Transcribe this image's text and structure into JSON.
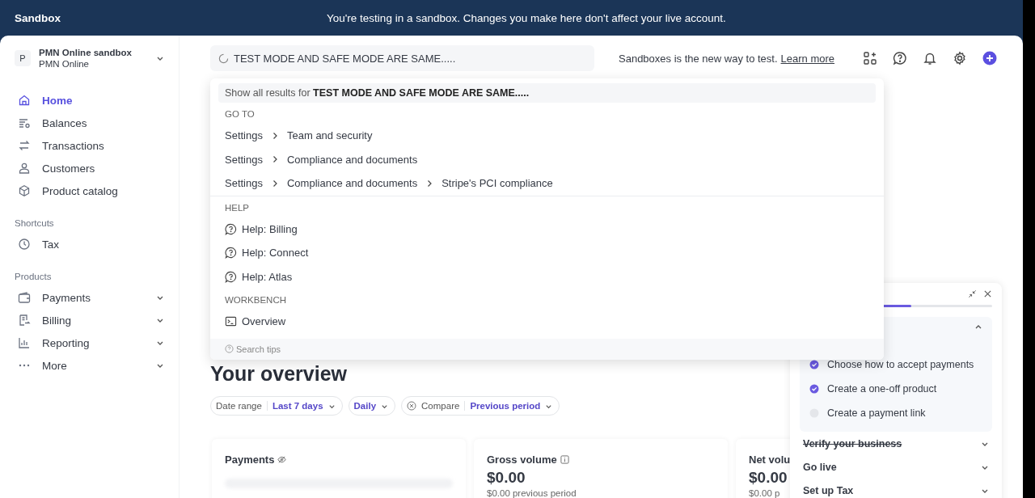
{
  "banner": {
    "label": "Sandbox",
    "message": "You're testing in a sandbox. Changes you make here don't affect your live account."
  },
  "account": {
    "avatar": "P",
    "name": "PMN Online sandbox",
    "subtitle": "PMN Online"
  },
  "nav": [
    {
      "label": "Home",
      "selected": true
    },
    {
      "label": "Balances",
      "selected": false
    },
    {
      "label": "Transactions",
      "selected": false
    },
    {
      "label": "Customers",
      "selected": false
    },
    {
      "label": "Product catalog",
      "selected": false
    }
  ],
  "shortcuts": {
    "heading": "Shortcuts",
    "items": [
      {
        "label": "Tax",
        "selected": false
      }
    ]
  },
  "products": {
    "heading": "Products",
    "items": [
      {
        "label": "Payments",
        "expanded": false
      },
      {
        "label": "Billing",
        "expanded": false
      },
      {
        "label": "Reporting",
        "expanded": false
      },
      {
        "label": "More",
        "expanded": false
      }
    ]
  },
  "search": {
    "value": "TEST MODE AND SAFE MODE ARE SAME....."
  },
  "topbar": {
    "note": "Sandboxes is the new way to test.",
    "link": "Learn more"
  },
  "results": {
    "show_all": "Show all results for **TEST MODE AND SAFE MODE ARE SAME.....**",
    "sections": [
      {
        "heading": "GO TO",
        "kind": "path",
        "items": [
          {
            "path": [
              "Settings",
              "Team and security"
            ]
          },
          {
            "path": [
              "Settings",
              "Compliance and documents"
            ]
          },
          {
            "path": [
              "Settings",
              "Compliance and documents",
              "Stripe's PCI compliance"
            ]
          }
        ]
      },
      {
        "heading": "HELP",
        "kind": "help",
        "items": [
          {
            "label": "Help: Billing"
          },
          {
            "label": "Help: Connect"
          },
          {
            "label": "Help: Atlas"
          }
        ]
      },
      {
        "heading": "WORKBENCH",
        "kind": "terminal",
        "items": [
          {
            "label": "Overview"
          }
        ]
      }
    ],
    "footer": "Search tips"
  },
  "overview": {
    "title": "Your overview",
    "filters": [
      {
        "label": "Date range",
        "value": "Last 7 days",
        "removable": false
      },
      {
        "value": "Daily",
        "removable": false
      },
      {
        "label": "Compare",
        "value": "Previous period",
        "removable": true
      }
    ]
  },
  "cards": [
    {
      "title": "Payments",
      "hidden": true,
      "info": false
    },
    {
      "title": "Gross volume",
      "hidden": false,
      "info": true,
      "amount": "$0.00",
      "comparison": "$0.00 previous period"
    },
    {
      "title": "Net volu",
      "hidden": false,
      "amount": "$0.00",
      "comparison": "$0.00 p"
    }
  ],
  "setup": {
    "level": 0.58,
    "expanded": true,
    "tasks": [
      {
        "label": "Choose how to accept payments",
        "done": true
      },
      {
        "label": "Create a one-off product",
        "done": true
      },
      {
        "label": "Create a payment link",
        "done": false
      }
    ],
    "steps": [
      {
        "label": "Verify your business",
        "done": true,
        "expanded": false
      },
      {
        "label": "Go live",
        "done": false,
        "expanded": false
      },
      {
        "label": "Set up Tax",
        "done": false,
        "expanded": false
      }
    ]
  }
}
